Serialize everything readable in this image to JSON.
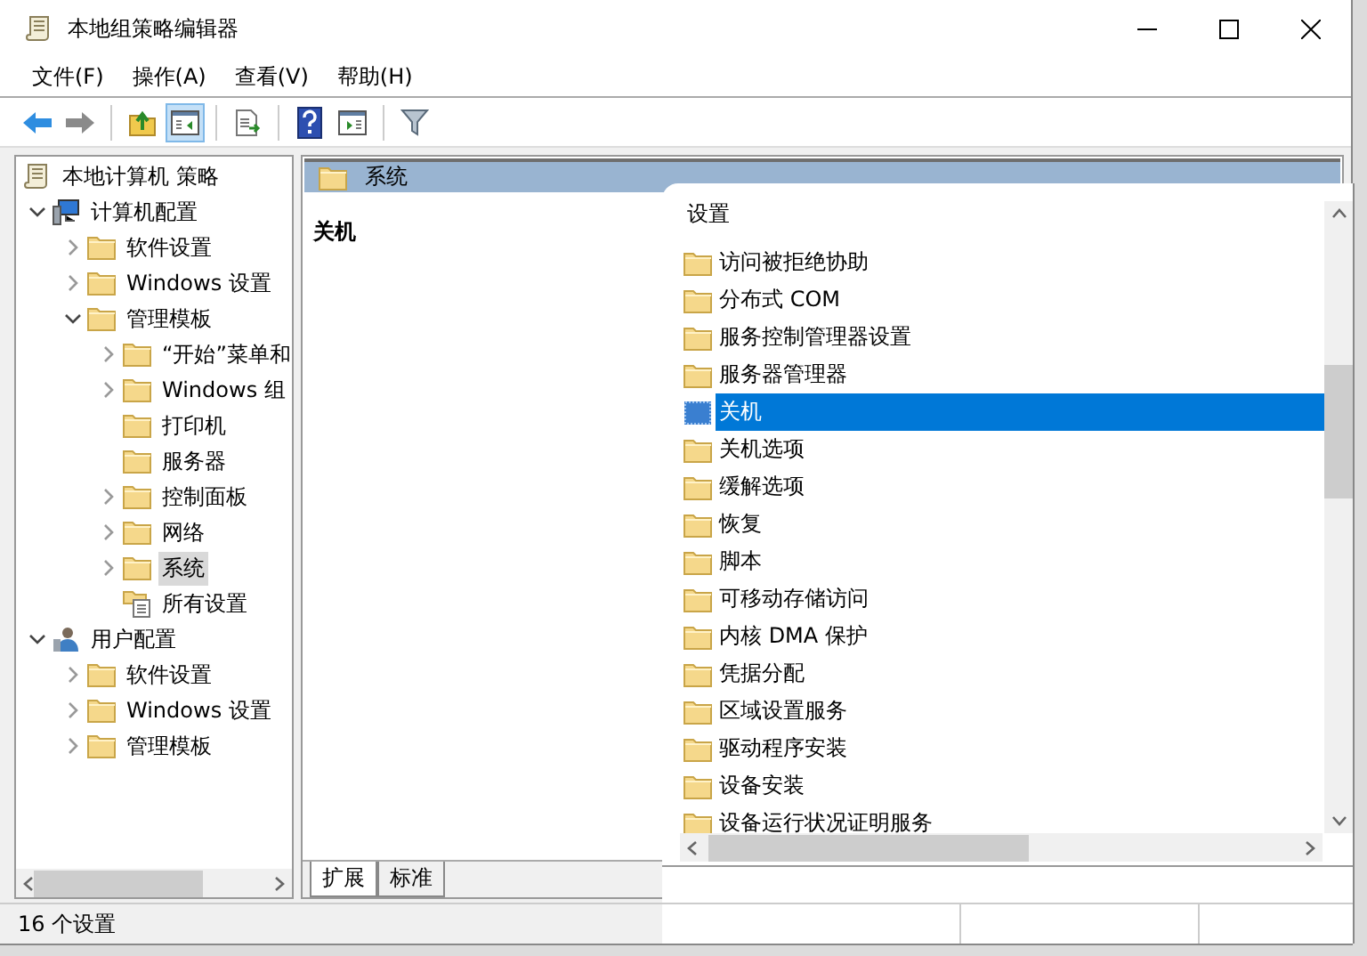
{
  "window": {
    "title": "本地组策略编辑器"
  },
  "menu": [
    "文件(F)",
    "操作(A)",
    "查看(V)",
    "帮助(H)"
  ],
  "toolbar": [
    [
      {
        "kind": "back",
        "pressed": false
      },
      {
        "kind": "forward",
        "pressed": false
      }
    ],
    [
      {
        "kind": "up",
        "pressed": false
      },
      {
        "kind": "tree",
        "pressed": true
      }
    ],
    [
      {
        "kind": "export",
        "pressed": false
      }
    ],
    [
      {
        "kind": "help",
        "pressed": false
      },
      {
        "kind": "pane",
        "pressed": false
      }
    ],
    [
      {
        "kind": "filter",
        "pressed": false
      }
    ]
  ],
  "tree": [
    {
      "label": "本地计算机 策略",
      "kind": "policy",
      "selected": false,
      "children": [
        {
          "label": "计算机配置",
          "kind": "computer",
          "expandable": true,
          "expanded": true,
          "selected": false,
          "children": [
            {
              "label": "软件设置",
              "kind": "folder",
              "expandable": true,
              "expanded": false,
              "selected": false
            },
            {
              "label": "Windows 设置",
              "kind": "folder",
              "expandable": true,
              "expanded": false,
              "selected": false
            },
            {
              "label": "管理模板",
              "kind": "folder",
              "expandable": true,
              "expanded": true,
              "selected": false,
              "children": [
                {
                  "label": "“开始”菜单和",
                  "kind": "folder",
                  "expandable": true,
                  "expanded": false,
                  "selected": false
                },
                {
                  "label": "Windows 组",
                  "kind": "folder",
                  "expandable": true,
                  "expanded": false,
                  "selected": false
                },
                {
                  "label": "打印机",
                  "kind": "folder",
                  "expandable": false,
                  "selected": false
                },
                {
                  "label": "服务器",
                  "kind": "folder",
                  "expandable": false,
                  "selected": false
                },
                {
                  "label": "控制面板",
                  "kind": "folder",
                  "expandable": true,
                  "expanded": false,
                  "selected": false
                },
                {
                  "label": "网络",
                  "kind": "folder",
                  "expandable": true,
                  "expanded": false,
                  "selected": false
                },
                {
                  "label": "系统",
                  "kind": "folder",
                  "expandable": true,
                  "expanded": false,
                  "selected": true
                },
                {
                  "label": "所有设置",
                  "kind": "settings",
                  "expandable": false,
                  "selected": false
                }
              ]
            }
          ]
        },
        {
          "label": "用户配置",
          "kind": "user",
          "expandable": true,
          "expanded": true,
          "selected": false,
          "children": [
            {
              "label": "软件设置",
              "kind": "folder",
              "expandable": true,
              "expanded": false,
              "selected": false
            },
            {
              "label": "Windows 设置",
              "kind": "folder",
              "expandable": true,
              "expanded": false,
              "selected": false
            },
            {
              "label": "管理模板",
              "kind": "folder",
              "expandable": true,
              "expanded": false,
              "selected": false
            }
          ]
        }
      ]
    }
  ],
  "details": {
    "header": "系统",
    "title": "关机",
    "tabs": [
      {
        "label": "扩展",
        "selected": true
      },
      {
        "label": "标准",
        "selected": false
      }
    ]
  },
  "status_bar": "16 个设置",
  "list": {
    "column": "设置",
    "items": [
      {
        "label": "访问被拒绝协助",
        "kind": "folder",
        "selected": false
      },
      {
        "label": "分布式 COM",
        "kind": "folder",
        "selected": false
      },
      {
        "label": "服务控制管理器设置",
        "kind": "folder",
        "selected": false
      },
      {
        "label": "服务器管理器",
        "kind": "folder",
        "selected": false
      },
      {
        "label": "关机",
        "kind": "setting",
        "selected": true
      },
      {
        "label": "关机选项",
        "kind": "folder",
        "selected": false
      },
      {
        "label": "缓解选项",
        "kind": "folder",
        "selected": false
      },
      {
        "label": "恢复",
        "kind": "folder",
        "selected": false
      },
      {
        "label": "脚本",
        "kind": "folder",
        "selected": false
      },
      {
        "label": "可移动存储访问",
        "kind": "folder",
        "selected": false
      },
      {
        "label": "内核 DMA 保护",
        "kind": "folder",
        "selected": false
      },
      {
        "label": "凭据分配",
        "kind": "folder",
        "selected": false
      },
      {
        "label": "区域设置服务",
        "kind": "folder",
        "selected": false
      },
      {
        "label": "驱动程序安装",
        "kind": "folder",
        "selected": false
      },
      {
        "label": "设备安装",
        "kind": "folder",
        "selected": false
      },
      {
        "label": "设备运行状况证明服务",
        "kind": "folder",
        "selected": false
      }
    ]
  }
}
